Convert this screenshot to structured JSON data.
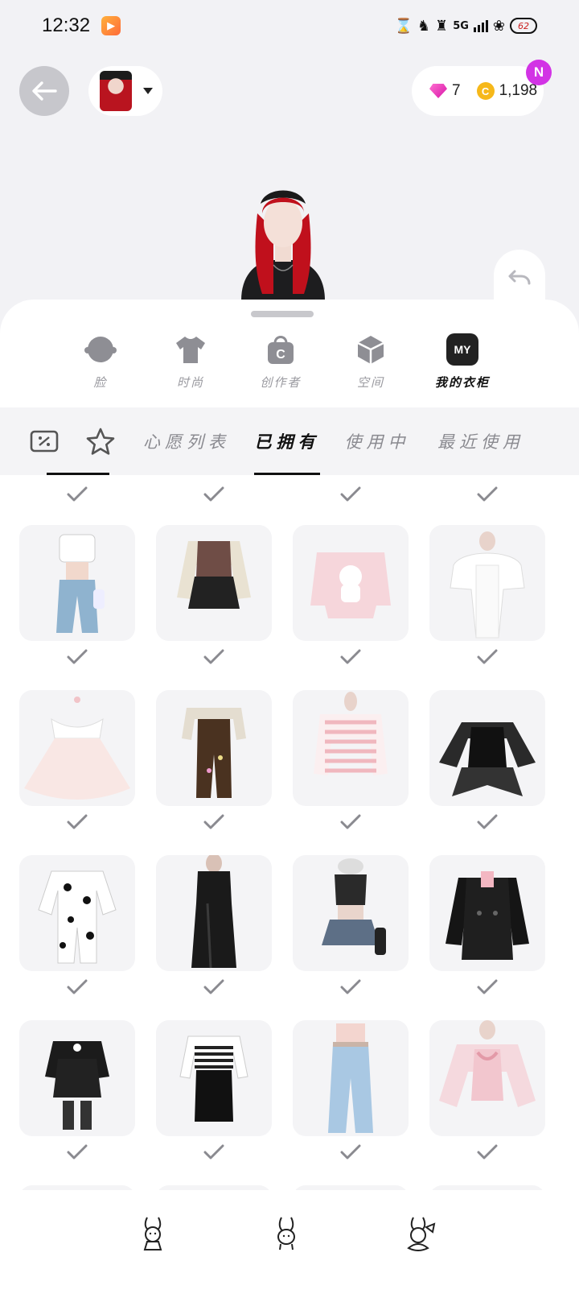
{
  "status_bar": {
    "time": "12:32",
    "app_icon": "video-app-icon",
    "battery_level": "62",
    "network": "5G"
  },
  "header": {
    "back_icon": "arrow-left-icon",
    "dropdown_icon": "caret-down-icon",
    "gems": "7",
    "coins": "1,198",
    "coin_symbol": "C",
    "notification_badge": "N"
  },
  "categories": [
    {
      "label": "脸",
      "icon": "face-icon"
    },
    {
      "label": "时尚",
      "icon": "tshirt-icon"
    },
    {
      "label": "创作者",
      "icon": "creator-bag-icon"
    },
    {
      "label": "空间",
      "icon": "cube-icon"
    },
    {
      "label": "我的衣柜",
      "icon": "my-closet-icon",
      "icon_text": "MY"
    }
  ],
  "filters": {
    "coupon_icon": "coupon-icon",
    "star_icon": "star-icon",
    "tabs": [
      {
        "label": "心愿列表"
      },
      {
        "label": "已拥有"
      },
      {
        "label": "使用中"
      },
      {
        "label": "最近使用"
      }
    ]
  },
  "closet_items": [
    {
      "name": "white-crop-top-denim-outfit",
      "owned": true
    },
    {
      "name": "sweater-vest-pleated-skirt",
      "owned": true
    },
    {
      "name": "pink-cat-sweater",
      "owned": true
    },
    {
      "name": "white-fur-strapless-dress",
      "owned": true
    },
    {
      "name": "pink-bow-bubble-dress",
      "owned": true
    },
    {
      "name": "brown-overalls-outfit",
      "owned": true
    },
    {
      "name": "pink-striped-sweater",
      "owned": true
    },
    {
      "name": "black-lace-corset-dress",
      "owned": true
    },
    {
      "name": "dalmatian-onesie",
      "owned": true
    },
    {
      "name": "black-satin-maxi-dress",
      "owned": true
    },
    {
      "name": "black-top-denim-skirt",
      "owned": true
    },
    {
      "name": "black-trench-coat",
      "owned": true
    },
    {
      "name": "black-gothic-dress-boots",
      "owned": true
    },
    {
      "name": "striped-tube-black-skirt",
      "owned": true
    },
    {
      "name": "light-blue-baggy-jeans",
      "owned": true
    },
    {
      "name": "pink-bow-fur-jacket",
      "owned": true
    }
  ],
  "bottom_nav": [
    {
      "icon": "bunny-girl-icon"
    },
    {
      "icon": "bunny-icon"
    },
    {
      "icon": "bunny-bow-icon"
    }
  ],
  "colors": {
    "background": "#f2f2f5",
    "accent_badge": "#d233e5",
    "gem": "#e52bbd",
    "coin": "#f6b81a",
    "hair": "#b9141f"
  }
}
